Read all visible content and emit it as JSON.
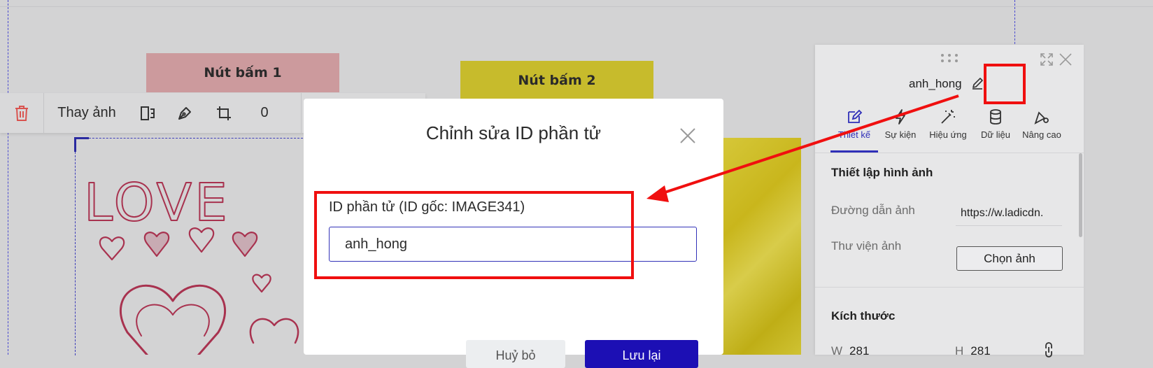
{
  "canvas": {
    "button1_label": "Nút bấm 1",
    "button2_label": "Nút bấm 2",
    "image_caption": "LOVE"
  },
  "toolbar": {
    "replace_image_label": "Thay ảnh",
    "rotation_value": "0",
    "icons": [
      "trash-icon",
      "flip-icon",
      "pen-icon",
      "crop-icon"
    ]
  },
  "modal": {
    "title": "Chỉnh sửa ID phần tử",
    "id_label": "ID phần tử (ID gốc: IMAGE341)",
    "id_value": "anh_hong",
    "cancel_label": "Huỷ bỏ",
    "save_label": "Lưu lại"
  },
  "panel": {
    "element_name": "anh_hong",
    "tabs": [
      {
        "label": "Thiết kế",
        "icon": "design-pen-icon",
        "active": true
      },
      {
        "label": "Sự kiện",
        "icon": "lightning-icon",
        "active": false
      },
      {
        "label": "Hiệu ứng",
        "icon": "magic-wand-icon",
        "active": false
      },
      {
        "label": "Dữ liệu",
        "icon": "database-icon",
        "active": false
      },
      {
        "label": "Nâng cao",
        "icon": "advanced-settings-icon",
        "active": false
      }
    ],
    "image_section": {
      "title": "Thiết lập hình ảnh",
      "url_label": "Đường dẫn ảnh",
      "url_value": "https://w.ladicdn.",
      "library_label": "Thư viện ảnh",
      "choose_label": "Chọn ảnh"
    },
    "size_section": {
      "title": "Kích thước",
      "w_label": "W",
      "w_value": "281",
      "h_label": "H",
      "h_value": "281"
    }
  },
  "colors": {
    "accent": "#1c0fb4",
    "highlight": "#f00f0f",
    "button1_bg": "#cc9a9d",
    "button2_bg": "#c7bb2c",
    "trash": "#d9534f"
  }
}
